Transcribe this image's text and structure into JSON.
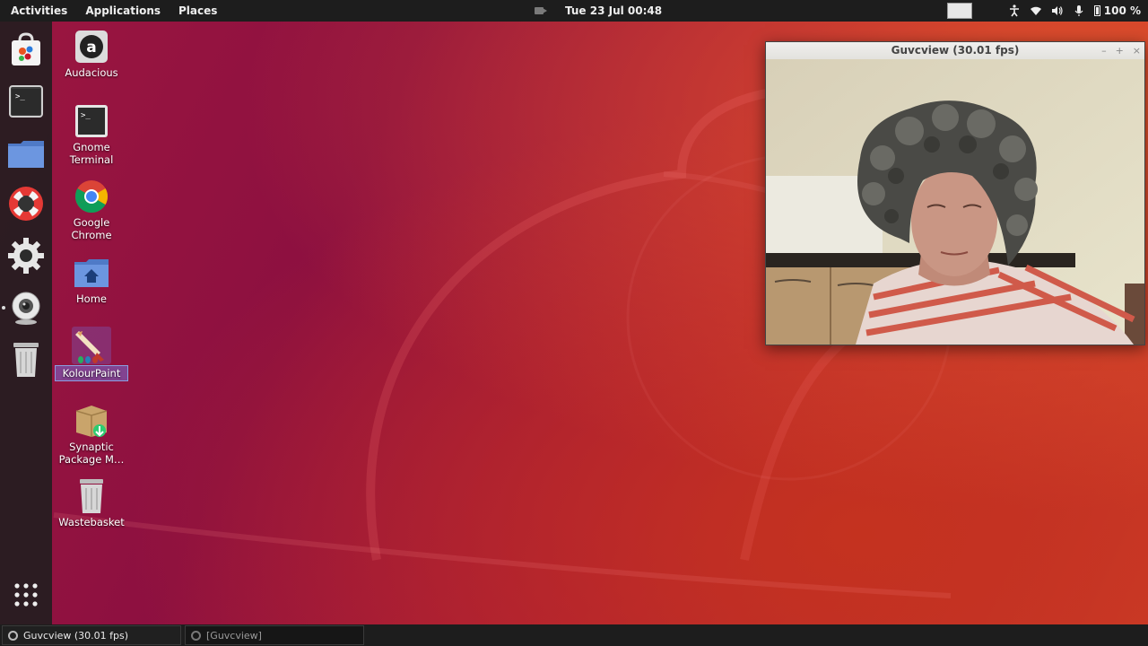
{
  "topbar": {
    "activities": "Activities",
    "applications": "Applications",
    "places": "Places",
    "clock": "Tue 23 Jul  00:48",
    "battery": "100 %"
  },
  "dock": {
    "items": [
      {
        "name": "software-store-icon"
      },
      {
        "name": "terminal-icon"
      },
      {
        "name": "files-icon"
      },
      {
        "name": "help-icon"
      },
      {
        "name": "settings-icon"
      },
      {
        "name": "webcam-icon",
        "running": true
      },
      {
        "name": "trash-icon"
      }
    ],
    "show_apps": "show-applications-icon"
  },
  "desktop": {
    "icons": [
      {
        "id": "audacious",
        "label": "Audacious"
      },
      {
        "id": "gnome-terminal",
        "label": "Gnome Terminal"
      },
      {
        "id": "google-chrome",
        "label": "Google Chrome"
      },
      {
        "id": "home",
        "label": "Home"
      },
      {
        "id": "kolourpaint",
        "label": "KolourPaint",
        "selected": true
      },
      {
        "id": "synaptic",
        "label": "Synaptic Package M…"
      },
      {
        "id": "wastebasket",
        "label": "Wastebasket"
      }
    ]
  },
  "window": {
    "title": "Guvcview  (30.01 fps)",
    "minimize": "–",
    "maximize": "+",
    "close": "×"
  },
  "taskbar": {
    "tasks": [
      {
        "label": "Guvcview  (30.01 fps)",
        "active": true
      },
      {
        "label": "[Guvcview]",
        "active": false
      }
    ]
  }
}
